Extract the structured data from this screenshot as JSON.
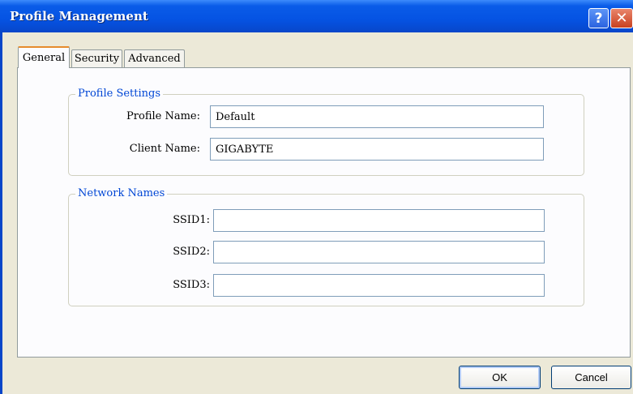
{
  "window": {
    "title": "Profile Management",
    "help_label": "?",
    "close_label": "✕"
  },
  "tabs": [
    {
      "label": "General",
      "active": true
    },
    {
      "label": "Security",
      "active": false
    },
    {
      "label": "Advanced",
      "active": false
    }
  ],
  "profile_settings": {
    "title": "Profile Settings",
    "profile_name_label": "Profile Name:",
    "profile_name_value": "Default",
    "client_name_label": "Client Name:",
    "client_name_value": "GIGABYTE"
  },
  "network_names": {
    "title": "Network Names",
    "ssid1_label": "SSID1:",
    "ssid1_value": "",
    "ssid2_label": "SSID2:",
    "ssid2_value": "",
    "ssid3_label": "SSID3:",
    "ssid3_value": ""
  },
  "buttons": {
    "ok_label": "OK",
    "cancel_label": "Cancel"
  },
  "colors": {
    "title_bar": "#0553e3",
    "group_title": "#0046d5",
    "active_tab_accent": "#e68b2c"
  }
}
